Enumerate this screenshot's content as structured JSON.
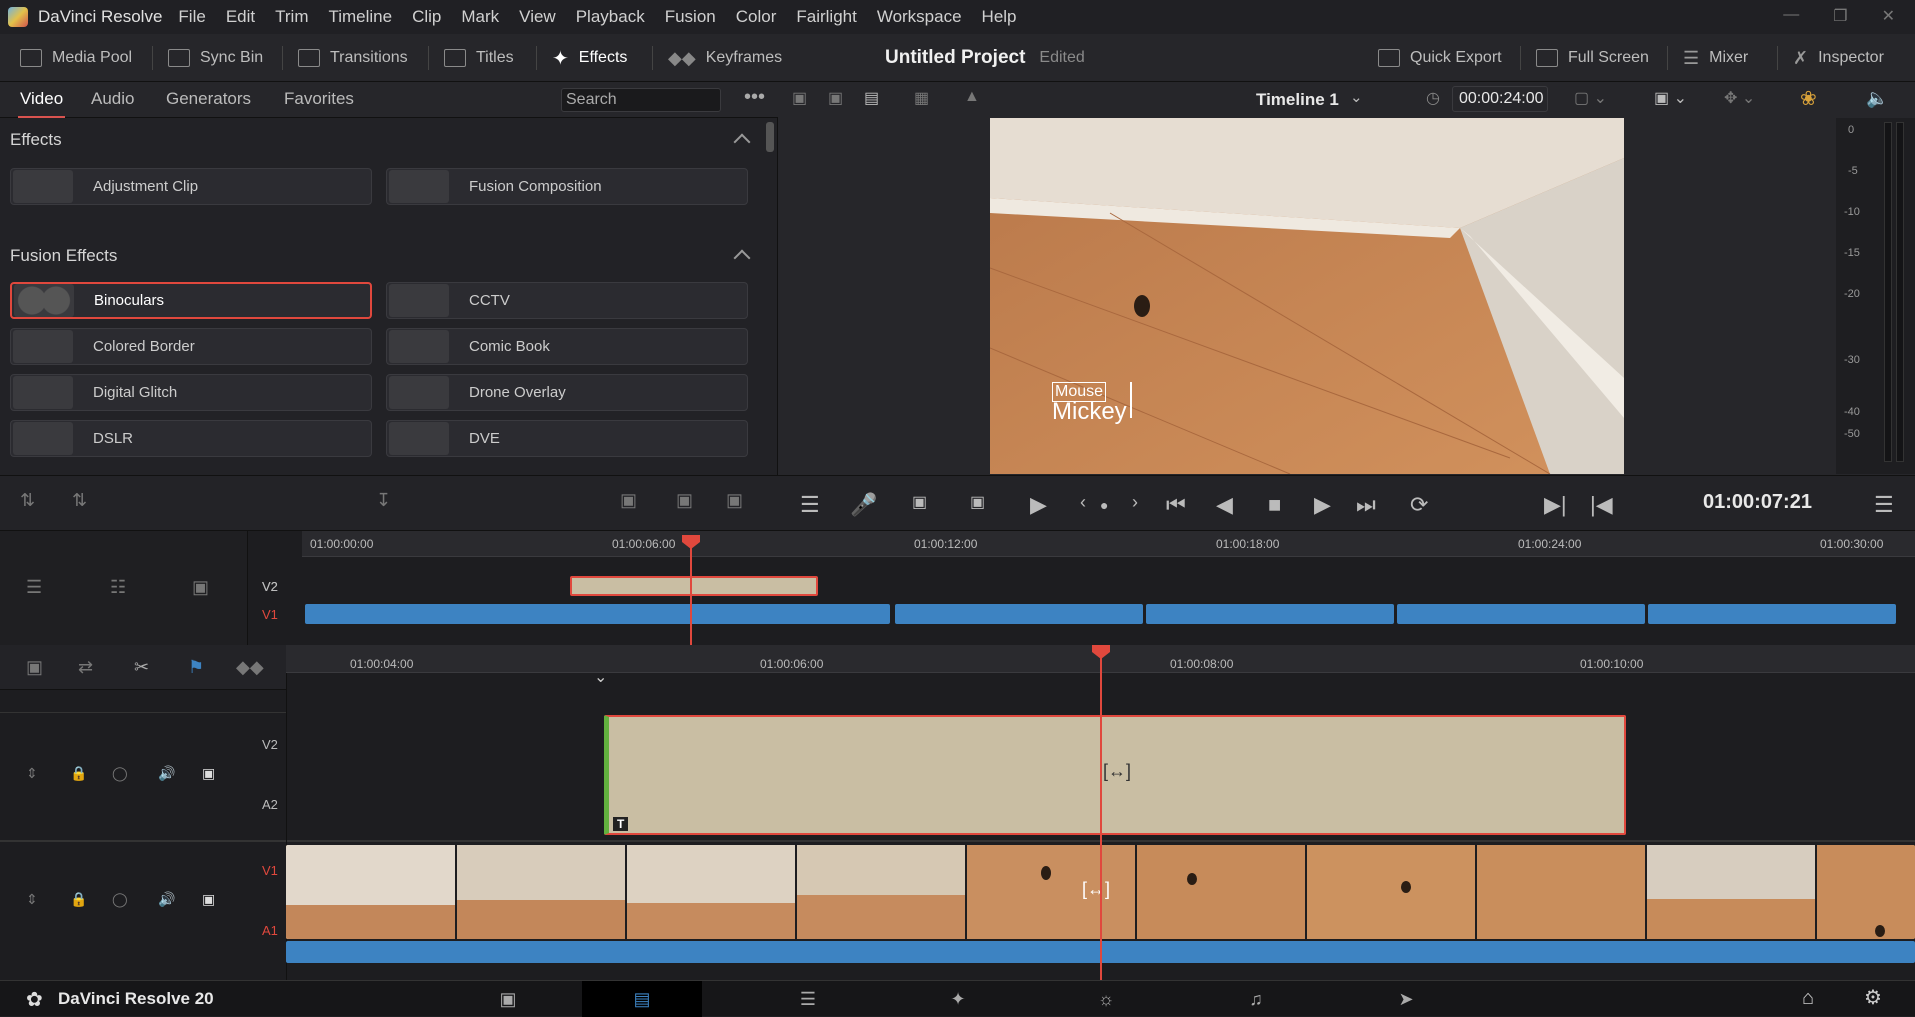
{
  "menu": {
    "app": "DaVinci Resolve",
    "items": [
      "File",
      "Edit",
      "Trim",
      "Timeline",
      "Clip",
      "Mark",
      "View",
      "Playback",
      "Fusion",
      "Color",
      "Fairlight",
      "Workspace",
      "Help"
    ]
  },
  "toolbar": {
    "media_pool": "Media Pool",
    "sync_bin": "Sync Bin",
    "transitions": "Transitions",
    "titles": "Titles",
    "effects": "Effects",
    "keyframes": "Keyframes",
    "quick_export": "Quick Export",
    "full_screen": "Full Screen",
    "mixer": "Mixer",
    "inspector": "Inspector"
  },
  "project": {
    "title": "Untitled Project",
    "status": "Edited"
  },
  "effects_panel": {
    "tabs": [
      "Video",
      "Audio",
      "Generators",
      "Favorites"
    ],
    "search_placeholder": "Search",
    "section_effects": "Effects",
    "section_fusion": "Fusion Effects",
    "effects": [
      "Adjustment Clip",
      "Fusion Composition"
    ],
    "fusion_effects": [
      "Binoculars",
      "CCTV",
      "Colored Border",
      "Comic Book",
      "Digital Glitch",
      "Drone Overlay",
      "DSLR",
      "DVE"
    ],
    "selected": "Binoculars"
  },
  "viewer": {
    "timeline_name": "Timeline 1",
    "duration": "00:00:24:00",
    "overlay_small": "Mouse",
    "overlay_large": "Mickey",
    "timecode": "01:00:07:21"
  },
  "meter_scale": [
    "0",
    "-5",
    "-10",
    "-15",
    "-20",
    "-30",
    "-40",
    "-50"
  ],
  "upper_ruler": [
    "01:00:00:00",
    "01:00:06:00",
    "01:00:12:00",
    "01:00:18:00",
    "01:00:24:00",
    "01:00:30:00"
  ],
  "lower_ruler": [
    "01:00:04:00",
    "01:00:06:00",
    "01:00:08:00",
    "01:00:10:00"
  ],
  "tracks": {
    "upper": [
      "V2",
      "V1"
    ],
    "lower_top": [
      "V2",
      "A2"
    ],
    "lower_bottom": [
      "V1",
      "A1"
    ]
  },
  "title_clip_badge": "T",
  "statusbar": {
    "app": "DaVinci Resolve 20"
  },
  "colors": {
    "accent": "#e0483d",
    "clip_blue": "#3d83c2",
    "title_clip": "#c9bea3"
  }
}
